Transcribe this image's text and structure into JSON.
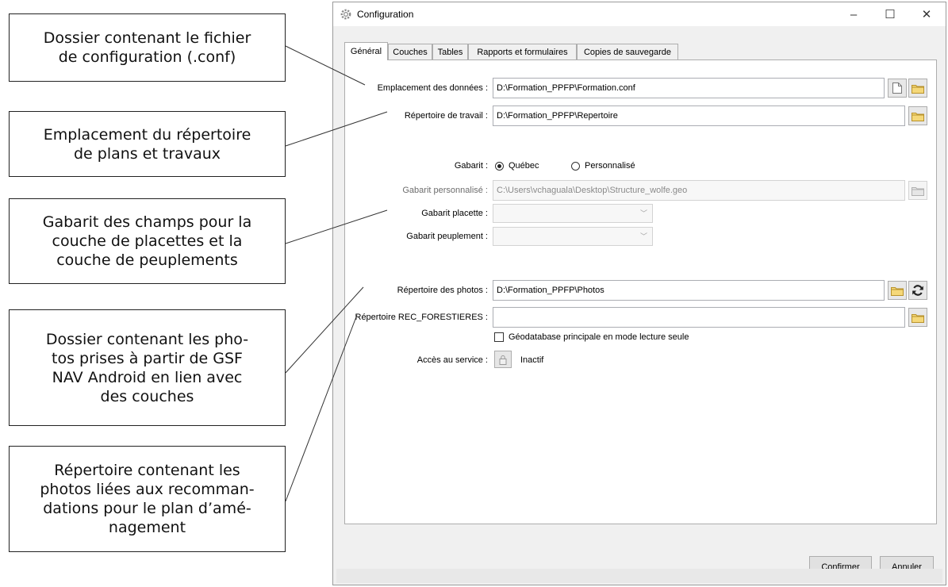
{
  "callouts": [
    {
      "lines": [
        "Dossier contenant le fichier",
        "de configuration (.conf)"
      ]
    },
    {
      "lines": [
        "Emplacement du répertoire",
        "de plans et travaux"
      ]
    },
    {
      "lines": [
        "Gabarit des champs pour la",
        "couche de placettes et la",
        "couche de peuplements"
      ]
    },
    {
      "lines": [
        "Dossier contenant les pho-",
        "tos prises à partir de GSF",
        "NAV Android en lien avec",
        "des couches"
      ]
    },
    {
      "lines": [
        "Répertoire contenant les",
        "photos liées aux recomman-",
        "dations pour le plan d’amé-",
        "nagement"
      ]
    }
  ],
  "window": {
    "title": "Configuration",
    "controls": {
      "minimize": "–",
      "maximize": "☐",
      "close": "✕"
    }
  },
  "tabs": [
    "Général",
    "Couches",
    "Tables",
    "Rapports et formulaires",
    "Copies de sauvegarde"
  ],
  "active_tab": "Général",
  "general": {
    "data_location": {
      "label": "Emplacement des données :",
      "value": "D:\\Formation_PPFP\\Formation.conf"
    },
    "work_dir": {
      "label": "Répertoire de travail :",
      "value": "D:\\Formation_PPFP\\Repertoire"
    },
    "template": {
      "label": "Gabarit :",
      "options": [
        "Québec",
        "Personnalisé"
      ],
      "selected": "Québec"
    },
    "custom_template": {
      "label": "Gabarit personnalisé :",
      "value": "C:\\Users\\vchaguala\\Desktop\\Structure_wolfe.geo"
    },
    "plot_template": {
      "label": "Gabarit placette :",
      "value": ""
    },
    "stand_template": {
      "label": "Gabarit peuplement :",
      "value": ""
    },
    "photos_dir": {
      "label": "Répertoire des photos :",
      "value": "D:\\Formation_PPFP\\Photos"
    },
    "rec_dir": {
      "label": "Répertoire REC_FORESTIERES :",
      "value": ""
    },
    "readonly_checkbox": {
      "label": "Géodatabase principale en mode lecture seule",
      "checked": false
    },
    "service": {
      "label": "Accès au service :",
      "status": "Inactif"
    }
  },
  "buttons": {
    "confirm": "Confirmer",
    "cancel": "Annuler"
  },
  "colors": {
    "folder": "#f5d879",
    "folder_border": "#b8922b",
    "accent": "#0078d7"
  },
  "icons": [
    "gear-icon",
    "new-file-icon",
    "folder-icon",
    "refresh-icon",
    "lock-icon"
  ]
}
